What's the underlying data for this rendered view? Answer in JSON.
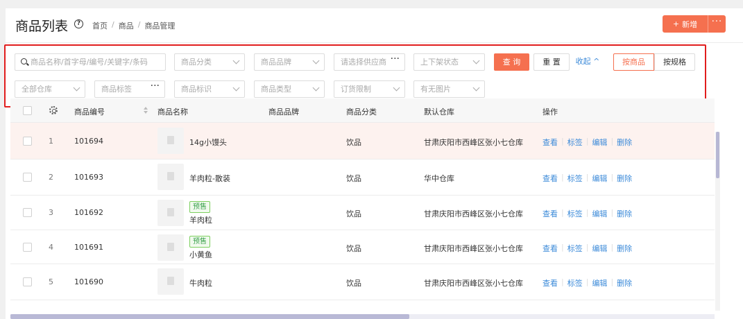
{
  "header": {
    "title": "商品列表",
    "help_icon": "?",
    "breadcrumbs": [
      "首页",
      "商品",
      "商品管理"
    ],
    "breadcrumb_sep": "/",
    "new_label": "新增",
    "new_icon": "+",
    "more_icon": "···"
  },
  "filters": {
    "search_placeholder": "商品名称/首字母/编号/关键字/条码",
    "category": "商品分类",
    "brand": "商品品牌",
    "supplier": "请选择供应商",
    "shelf_status": "上下架状态",
    "warehouse": "全部仓库",
    "tag": "商品标签",
    "mark": "商品标识",
    "type": "商品类型",
    "order_limit": "订货限制",
    "has_image": "有无图片",
    "dots": "···",
    "query_label": "查 询",
    "reset_label": "重 置",
    "collapse_label": "收起",
    "collapse_icon": "^",
    "by_product_label": "按商品",
    "by_spec_label": "按规格"
  },
  "table": {
    "columns": [
      "商品编号",
      "商品名称",
      "商品品牌",
      "商品分类",
      "默认仓库",
      "操作"
    ],
    "rows": [
      {
        "index": "1",
        "code": "101694",
        "name": "14g小馒头",
        "badge": "",
        "brand": "",
        "category": "饮品",
        "warehouse": "甘肃庆阳市西峰区张小七仓库"
      },
      {
        "index": "2",
        "code": "101693",
        "name": "羊肉粒-散装",
        "badge": "",
        "brand": "",
        "category": "饮品",
        "warehouse": "华中仓库"
      },
      {
        "index": "3",
        "code": "101692",
        "name": "羊肉粒",
        "badge": "预售",
        "brand": "",
        "category": "饮品",
        "warehouse": "甘肃庆阳市西峰区张小七仓库"
      },
      {
        "index": "4",
        "code": "101691",
        "name": "小黄鱼",
        "badge": "预售",
        "brand": "",
        "category": "饮品",
        "warehouse": "甘肃庆阳市西峰区张小七仓库"
      },
      {
        "index": "5",
        "code": "101690",
        "name": "牛肉粒",
        "badge": "",
        "brand": "",
        "category": "饮品",
        "warehouse": "甘肃庆阳市西峰区张小七仓库"
      }
    ],
    "ops": [
      "查看",
      "标签",
      "编辑",
      "删除"
    ],
    "op_sep": "|"
  },
  "colors": {
    "accent": "#f5704f",
    "link": "#3d8bd9",
    "highlight_border": "#e11d1d"
  }
}
